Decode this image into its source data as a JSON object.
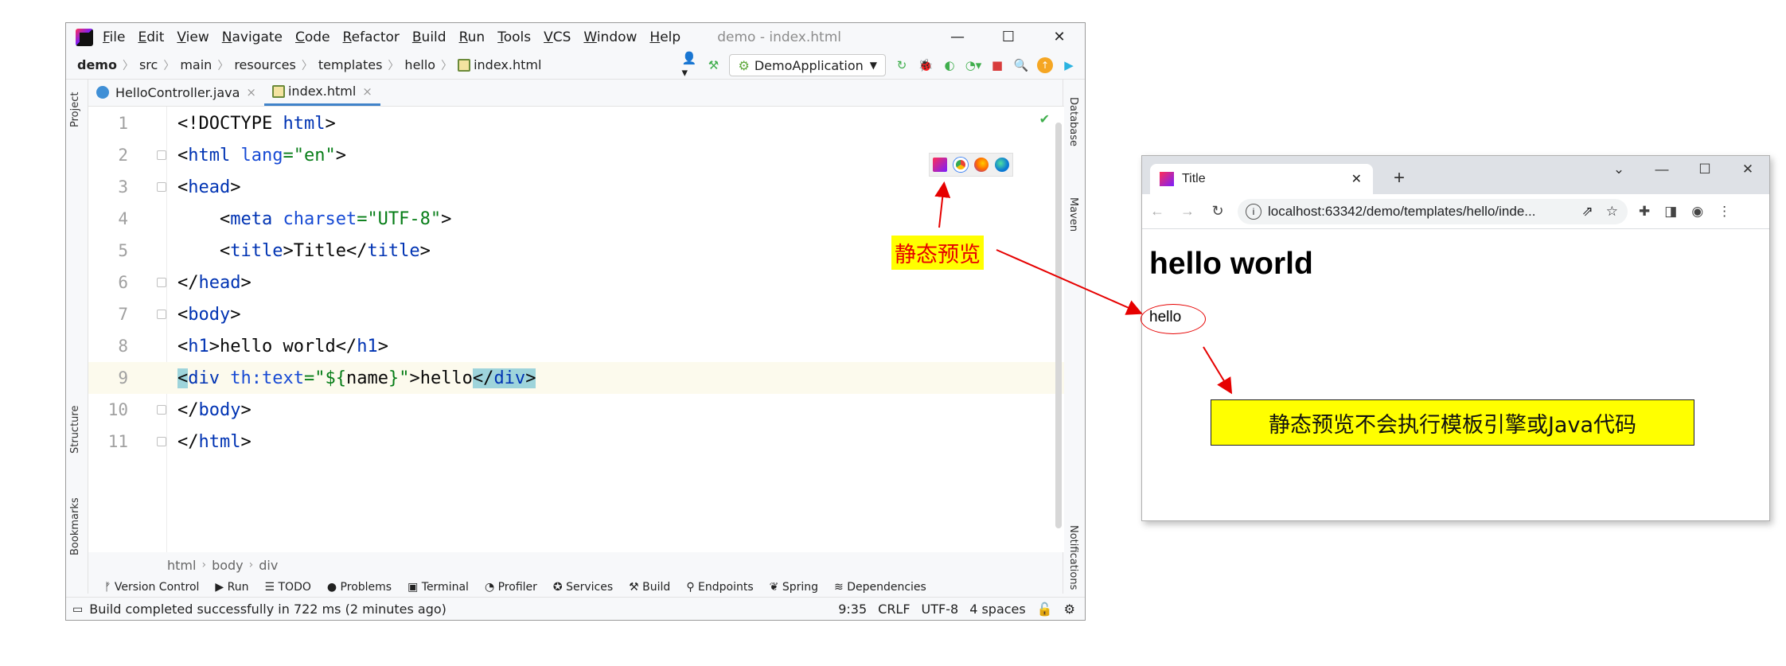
{
  "ide": {
    "menu": [
      "File",
      "Edit",
      "View",
      "Navigate",
      "Code",
      "Refactor",
      "Build",
      "Run",
      "Tools",
      "VCS",
      "Window",
      "Help"
    ],
    "window_title": "demo - index.html",
    "win_min": "—",
    "win_max": "☐",
    "win_close": "✕",
    "breadcrumb": [
      "demo",
      "src",
      "main",
      "resources",
      "templates",
      "hello",
      "index.html"
    ],
    "run_config": "DemoApplication",
    "tabs": [
      {
        "label": "HelloController.java",
        "close": "×"
      },
      {
        "label": "index.html",
        "close": "×"
      }
    ],
    "left_tool_labels": [
      "Project",
      "Structure",
      "Bookmarks"
    ],
    "right_tool_labels": [
      "Database",
      "Maven",
      "Notifications"
    ],
    "code_lines": [
      {
        "n": "1"
      },
      {
        "n": "2"
      },
      {
        "n": "3"
      },
      {
        "n": "4"
      },
      {
        "n": "5"
      },
      {
        "n": "6"
      },
      {
        "n": "7"
      },
      {
        "n": "8"
      },
      {
        "n": "9"
      },
      {
        "n": "10"
      },
      {
        "n": "11"
      }
    ],
    "code": {
      "l1a": "<!DOCTYPE ",
      "l1b": "html",
      "l1c": ">",
      "l2a": "<",
      "l2b": "html",
      "l2c": " lang",
      "l2d": "=",
      "l2e": "\"en\"",
      "l2f": ">",
      "l3a": "<",
      "l3b": "head",
      "l3c": ">",
      "l4a": "    <",
      "l4b": "meta",
      "l4c": " charset",
      "l4d": "=",
      "l4e": "\"UTF-8\"",
      "l4f": ">",
      "l5a": "    <",
      "l5b": "title",
      "l5c": ">Title</",
      "l5d": "title",
      "l5e": ">",
      "l6a": "</",
      "l6b": "head",
      "l6c": ">",
      "l7a": "<",
      "l7b": "body",
      "l7c": ">",
      "l8a": "<",
      "l8b": "h1",
      "l8c": ">hello world</",
      "l8d": "h1",
      "l8e": ">",
      "l9a": "<",
      "l9b": "div",
      "l9c": " th:text",
      "l9d": "=",
      "l9e": "\"${",
      "l9f": "name",
      "l9g": "}\"",
      "l9h": ">hello",
      "l9i": "</",
      "l9j": "div",
      "l9k": ">",
      "l10a": "</",
      "l10b": "body",
      "l10c": ">",
      "l11a": "</",
      "l11b": "html",
      "l11c": ">"
    },
    "bottom_breadcrumb": [
      "html",
      "body",
      "div"
    ],
    "tool_windows": [
      "Version Control",
      "Run",
      "TODO",
      "Problems",
      "Terminal",
      "Profiler",
      "Services",
      "Build",
      "Endpoints",
      "Spring",
      "Dependencies"
    ],
    "status_message": "Build completed successfully in 722 ms (2 minutes ago)",
    "status_right": [
      "9:35",
      "CRLF",
      "UTF-8",
      "4 spaces"
    ]
  },
  "annotations": {
    "static_preview_label": "静态预览",
    "note": "静态预览不会执行模板引擎或Java代码"
  },
  "browser": {
    "tab_title": "Title",
    "tab_close": "✕",
    "new_tab": "+",
    "url": "localhost:63342/demo/templates/hello/inde...",
    "h1": "hello world",
    "div_text": "hello"
  }
}
